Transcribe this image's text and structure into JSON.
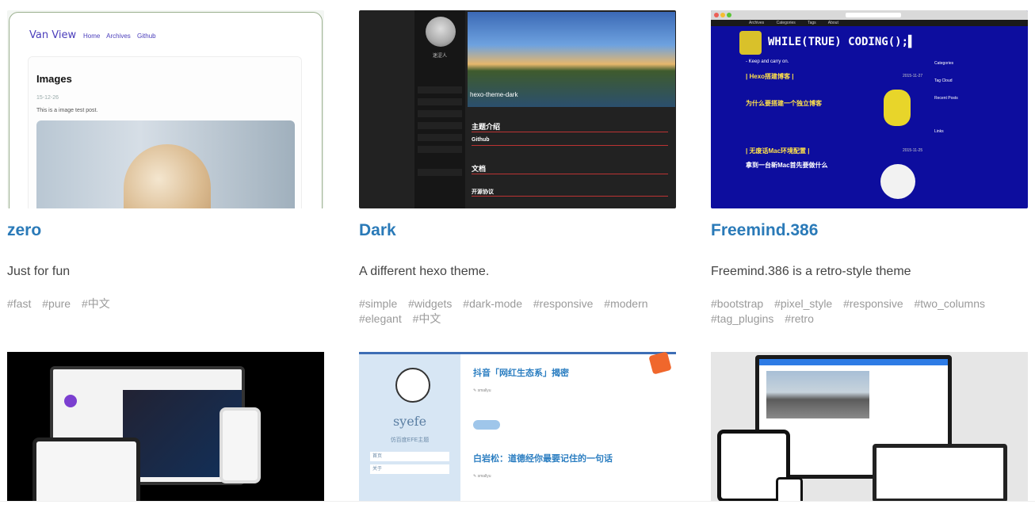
{
  "cards": [
    {
      "title": "zero",
      "description": "Just for fun",
      "tags": [
        "#fast",
        "#pure",
        "#中文"
      ],
      "preview": {
        "brand": "Van View",
        "nav": [
          "Home",
          "Archives",
          "Github"
        ],
        "post_title": "Images",
        "post_date": "15-12-26",
        "post_text": "This is a image test post."
      }
    },
    {
      "title": "Dark",
      "description": "A different hexo theme.",
      "tags": [
        "#simple",
        "#widgets",
        "#dark-mode",
        "#responsive",
        "#modern",
        "#elegant",
        "#中文"
      ],
      "preview": {
        "profile_name": "迷涩人",
        "hero_text": "hexo-theme-dark",
        "sections": [
          "主题介绍",
          "Github",
          "文档",
          "开源协议"
        ]
      }
    },
    {
      "title": "Freemind.386",
      "description": "Freemind.386 is a retro-style theme",
      "tags": [
        "#bootstrap",
        "#pixel_style",
        "#responsive",
        "#two_columns",
        "#tag_plugins",
        "#retro"
      ],
      "preview": {
        "heading": "WHILE(TRUE) CODING();▌",
        "tagline": "- Keep and carry on.",
        "posts": [
          {
            "title": "| Hexo搭建博客 |",
            "date": "2015-11-27"
          },
          {
            "title": "为什么要搭建一个独立博客",
            "date": ""
          },
          {
            "title": "| 无废话Mac环境配置 |",
            "date": "2015-11-25"
          },
          {
            "title": "拿到一台新Mac首先要做什么",
            "date": ""
          }
        ],
        "sidebar": [
          "Categories",
          "Tag Cloud",
          "Recent Posts",
          "Links"
        ],
        "menu": [
          "Archives",
          "Categories",
          "Tags",
          "About"
        ]
      }
    },
    {
      "title": "",
      "description": "",
      "tags": [],
      "preview": {}
    },
    {
      "title": "",
      "description": "",
      "tags": [],
      "preview": {
        "site_name": "syefe",
        "site_desc": "仿百度EFE主题",
        "nav": [
          "首页",
          "关于"
        ],
        "post1": "抖音「网红生态系」揭密",
        "post2": "白岩松：道德经你最要记住的一句话",
        "author": "✎ smallyu"
      }
    },
    {
      "title": "",
      "description": "",
      "tags": [],
      "preview": {}
    }
  ],
  "colors": {
    "title_link": "#2a7ab8",
    "tag_text": "#9a9a9a",
    "desc_text": "#444444"
  }
}
